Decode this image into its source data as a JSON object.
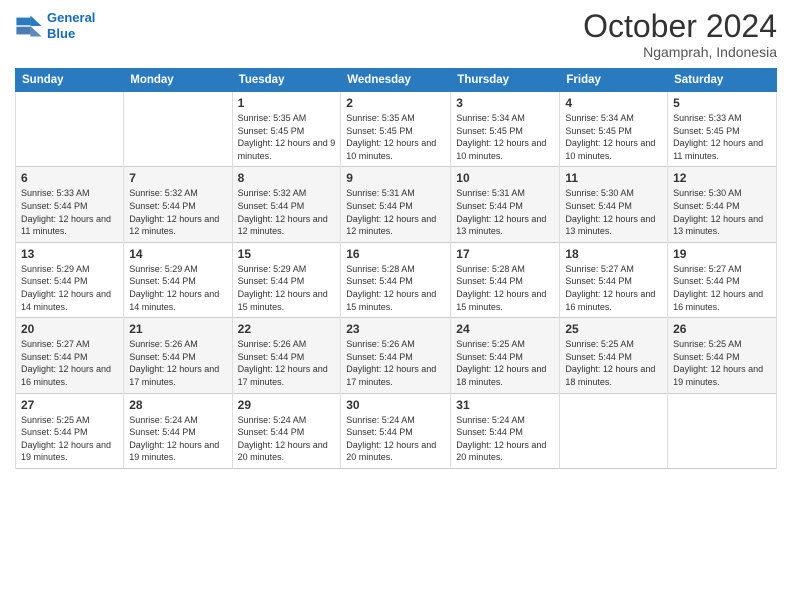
{
  "logo": {
    "line1": "General",
    "line2": "Blue"
  },
  "title": "October 2024",
  "location": "Ngamprah, Indonesia",
  "days_of_week": [
    "Sunday",
    "Monday",
    "Tuesday",
    "Wednesday",
    "Thursday",
    "Friday",
    "Saturday"
  ],
  "weeks": [
    [
      {
        "day": "",
        "sunrise": "",
        "sunset": "",
        "daylight": ""
      },
      {
        "day": "",
        "sunrise": "",
        "sunset": "",
        "daylight": ""
      },
      {
        "day": "1",
        "sunrise": "Sunrise: 5:35 AM",
        "sunset": "Sunset: 5:45 PM",
        "daylight": "Daylight: 12 hours and 9 minutes."
      },
      {
        "day": "2",
        "sunrise": "Sunrise: 5:35 AM",
        "sunset": "Sunset: 5:45 PM",
        "daylight": "Daylight: 12 hours and 10 minutes."
      },
      {
        "day": "3",
        "sunrise": "Sunrise: 5:34 AM",
        "sunset": "Sunset: 5:45 PM",
        "daylight": "Daylight: 12 hours and 10 minutes."
      },
      {
        "day": "4",
        "sunrise": "Sunrise: 5:34 AM",
        "sunset": "Sunset: 5:45 PM",
        "daylight": "Daylight: 12 hours and 10 minutes."
      },
      {
        "day": "5",
        "sunrise": "Sunrise: 5:33 AM",
        "sunset": "Sunset: 5:45 PM",
        "daylight": "Daylight: 12 hours and 11 minutes."
      }
    ],
    [
      {
        "day": "6",
        "sunrise": "Sunrise: 5:33 AM",
        "sunset": "Sunset: 5:44 PM",
        "daylight": "Daylight: 12 hours and 11 minutes."
      },
      {
        "day": "7",
        "sunrise": "Sunrise: 5:32 AM",
        "sunset": "Sunset: 5:44 PM",
        "daylight": "Daylight: 12 hours and 12 minutes."
      },
      {
        "day": "8",
        "sunrise": "Sunrise: 5:32 AM",
        "sunset": "Sunset: 5:44 PM",
        "daylight": "Daylight: 12 hours and 12 minutes."
      },
      {
        "day": "9",
        "sunrise": "Sunrise: 5:31 AM",
        "sunset": "Sunset: 5:44 PM",
        "daylight": "Daylight: 12 hours and 12 minutes."
      },
      {
        "day": "10",
        "sunrise": "Sunrise: 5:31 AM",
        "sunset": "Sunset: 5:44 PM",
        "daylight": "Daylight: 12 hours and 13 minutes."
      },
      {
        "day": "11",
        "sunrise": "Sunrise: 5:30 AM",
        "sunset": "Sunset: 5:44 PM",
        "daylight": "Daylight: 12 hours and 13 minutes."
      },
      {
        "day": "12",
        "sunrise": "Sunrise: 5:30 AM",
        "sunset": "Sunset: 5:44 PM",
        "daylight": "Daylight: 12 hours and 13 minutes."
      }
    ],
    [
      {
        "day": "13",
        "sunrise": "Sunrise: 5:29 AM",
        "sunset": "Sunset: 5:44 PM",
        "daylight": "Daylight: 12 hours and 14 minutes."
      },
      {
        "day": "14",
        "sunrise": "Sunrise: 5:29 AM",
        "sunset": "Sunset: 5:44 PM",
        "daylight": "Daylight: 12 hours and 14 minutes."
      },
      {
        "day": "15",
        "sunrise": "Sunrise: 5:29 AM",
        "sunset": "Sunset: 5:44 PM",
        "daylight": "Daylight: 12 hours and 15 minutes."
      },
      {
        "day": "16",
        "sunrise": "Sunrise: 5:28 AM",
        "sunset": "Sunset: 5:44 PM",
        "daylight": "Daylight: 12 hours and 15 minutes."
      },
      {
        "day": "17",
        "sunrise": "Sunrise: 5:28 AM",
        "sunset": "Sunset: 5:44 PM",
        "daylight": "Daylight: 12 hours and 15 minutes."
      },
      {
        "day": "18",
        "sunrise": "Sunrise: 5:27 AM",
        "sunset": "Sunset: 5:44 PM",
        "daylight": "Daylight: 12 hours and 16 minutes."
      },
      {
        "day": "19",
        "sunrise": "Sunrise: 5:27 AM",
        "sunset": "Sunset: 5:44 PM",
        "daylight": "Daylight: 12 hours and 16 minutes."
      }
    ],
    [
      {
        "day": "20",
        "sunrise": "Sunrise: 5:27 AM",
        "sunset": "Sunset: 5:44 PM",
        "daylight": "Daylight: 12 hours and 16 minutes."
      },
      {
        "day": "21",
        "sunrise": "Sunrise: 5:26 AM",
        "sunset": "Sunset: 5:44 PM",
        "daylight": "Daylight: 12 hours and 17 minutes."
      },
      {
        "day": "22",
        "sunrise": "Sunrise: 5:26 AM",
        "sunset": "Sunset: 5:44 PM",
        "daylight": "Daylight: 12 hours and 17 minutes."
      },
      {
        "day": "23",
        "sunrise": "Sunrise: 5:26 AM",
        "sunset": "Sunset: 5:44 PM",
        "daylight": "Daylight: 12 hours and 17 minutes."
      },
      {
        "day": "24",
        "sunrise": "Sunrise: 5:25 AM",
        "sunset": "Sunset: 5:44 PM",
        "daylight": "Daylight: 12 hours and 18 minutes."
      },
      {
        "day": "25",
        "sunrise": "Sunrise: 5:25 AM",
        "sunset": "Sunset: 5:44 PM",
        "daylight": "Daylight: 12 hours and 18 minutes."
      },
      {
        "day": "26",
        "sunrise": "Sunrise: 5:25 AM",
        "sunset": "Sunset: 5:44 PM",
        "daylight": "Daylight: 12 hours and 19 minutes."
      }
    ],
    [
      {
        "day": "27",
        "sunrise": "Sunrise: 5:25 AM",
        "sunset": "Sunset: 5:44 PM",
        "daylight": "Daylight: 12 hours and 19 minutes."
      },
      {
        "day": "28",
        "sunrise": "Sunrise: 5:24 AM",
        "sunset": "Sunset: 5:44 PM",
        "daylight": "Daylight: 12 hours and 19 minutes."
      },
      {
        "day": "29",
        "sunrise": "Sunrise: 5:24 AM",
        "sunset": "Sunset: 5:44 PM",
        "daylight": "Daylight: 12 hours and 20 minutes."
      },
      {
        "day": "30",
        "sunrise": "Sunrise: 5:24 AM",
        "sunset": "Sunset: 5:44 PM",
        "daylight": "Daylight: 12 hours and 20 minutes."
      },
      {
        "day": "31",
        "sunrise": "Sunrise: 5:24 AM",
        "sunset": "Sunset: 5:44 PM",
        "daylight": "Daylight: 12 hours and 20 minutes."
      },
      {
        "day": "",
        "sunrise": "",
        "sunset": "",
        "daylight": ""
      },
      {
        "day": "",
        "sunrise": "",
        "sunset": "",
        "daylight": ""
      }
    ]
  ]
}
